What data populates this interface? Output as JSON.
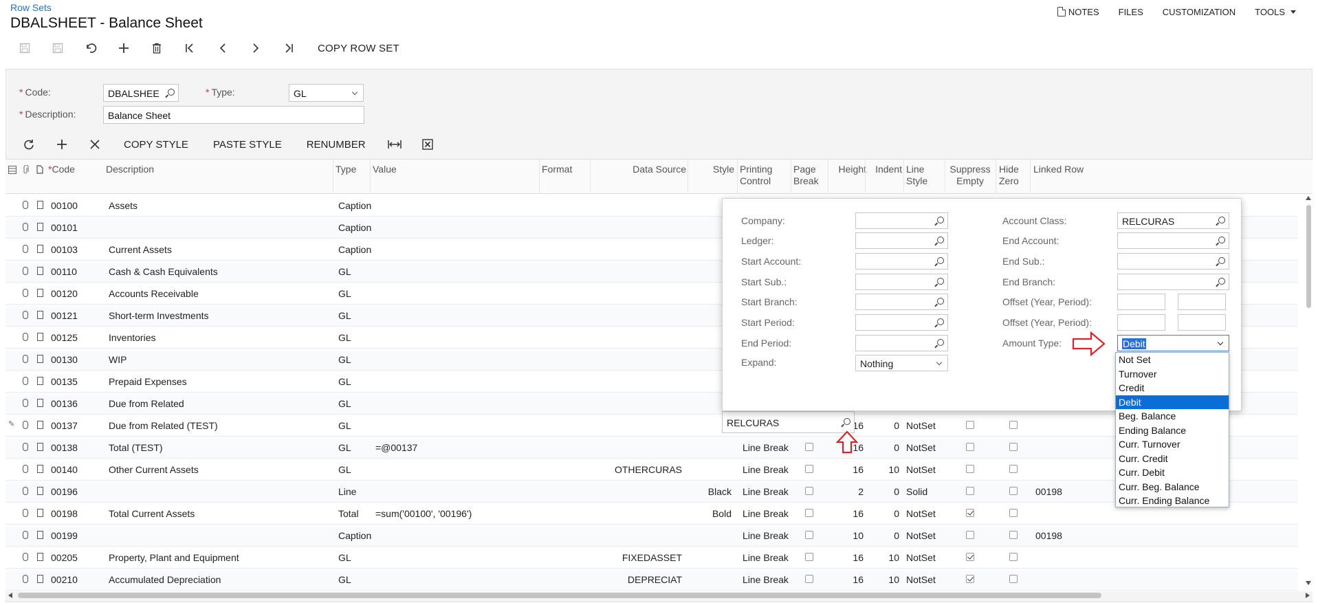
{
  "header": {
    "breadcrumb": "Row Sets",
    "title": "DBALSHEET - Balance Sheet",
    "actions": [
      {
        "label": "NOTES",
        "icon": "note-icon"
      },
      {
        "label": "FILES"
      },
      {
        "label": "CUSTOMIZATION"
      },
      {
        "label": "TOOLS",
        "dropdown": true
      }
    ]
  },
  "toolbar": {
    "icons": [
      "save-close-icon",
      "save-icon",
      "undo-icon",
      "add-icon",
      "delete-icon",
      "first-icon",
      "prev-icon",
      "next-icon",
      "last-icon"
    ],
    "copy_row_set": "COPY ROW SET"
  },
  "form": {
    "code_label": "Code:",
    "code_value": "DBALSHEE",
    "type_label": "Type:",
    "type_value": "GL",
    "description_label": "Description:",
    "description_value": "Balance Sheet"
  },
  "grid_toolbar": {
    "copy_style": "COPY STYLE",
    "paste_style": "PASTE STYLE",
    "renumber": "RENUMBER"
  },
  "columns": {
    "code": "Code",
    "description": "Description",
    "type": "Type",
    "value": "Value",
    "format": "Format",
    "data_source": "Data Source",
    "style": "Style",
    "printing_control_1": "Printing",
    "printing_control_2": "Control",
    "page_break_1": "Page",
    "page_break_2": "Break",
    "height": "Height",
    "indent": "Indent",
    "line_style_1": "Line",
    "line_style_2": "Style",
    "suppress_empty_1": "Suppress",
    "suppress_empty_2": "Empty",
    "hide_zero_1": "Hide",
    "hide_zero_2": "Zero",
    "linked_row": "Linked Row"
  },
  "rows": [
    {
      "code": "00100",
      "description": "Assets",
      "type": "Caption",
      "value": "",
      "data_source": "",
      "style": "",
      "printing": "",
      "height": "",
      "indent": "",
      "line_style": "",
      "linked": ""
    },
    {
      "code": "00101",
      "description": "",
      "type": "Caption",
      "value": "",
      "data_source": "",
      "style": "",
      "printing": "",
      "height": "",
      "indent": "",
      "line_style": "",
      "linked": ""
    },
    {
      "code": "00103",
      "description": "Current Assets",
      "type": "Caption",
      "value": "",
      "data_source": "",
      "style": "",
      "printing": "",
      "height": "",
      "indent": "",
      "line_style": "",
      "linked": "00198"
    },
    {
      "code": "00110",
      "description": "Cash & Cash Equivalents",
      "type": "GL",
      "value": "",
      "data_source": "",
      "style": "",
      "printing": "",
      "height": "",
      "indent": "",
      "line_style": "",
      "linked": ""
    },
    {
      "code": "00120",
      "description": "Accounts Receivable",
      "type": "GL",
      "value": "",
      "data_source": "",
      "style": "",
      "printing": "",
      "height": "",
      "indent": "",
      "line_style": "",
      "linked": ""
    },
    {
      "code": "00121",
      "description": "Short-term Investments",
      "type": "GL",
      "value": "",
      "data_source": "",
      "style": "",
      "printing": "",
      "height": "",
      "indent": "",
      "line_style": "",
      "linked": ""
    },
    {
      "code": "00125",
      "description": "Inventories",
      "type": "GL",
      "value": "",
      "data_source": "",
      "style": "",
      "printing": "",
      "height": "",
      "indent": "",
      "line_style": "",
      "linked": ""
    },
    {
      "code": "00130",
      "description": "WIP",
      "type": "GL",
      "value": "",
      "data_source": "",
      "style": "",
      "printing": "",
      "height": "",
      "indent": "",
      "line_style": "",
      "linked": ""
    },
    {
      "code": "00135",
      "description": "Prepaid Expenses",
      "type": "GL",
      "value": "",
      "data_source": "",
      "style": "",
      "printing": "",
      "height": "",
      "indent": "",
      "line_style": "",
      "linked": ""
    },
    {
      "code": "00136",
      "description": "Due from Related",
      "type": "GL",
      "value": "",
      "data_source": "",
      "style": "",
      "printing": "",
      "height": "",
      "indent": "",
      "line_style": "",
      "linked": ""
    },
    {
      "code": "00137",
      "description": "Due from Related (TEST)",
      "type": "GL",
      "value": "",
      "data_source": "",
      "style": "",
      "printing": "Line Break",
      "height": "16",
      "indent": "0",
      "line_style": "NotSet",
      "linked": ""
    },
    {
      "code": "00138",
      "description": "Total (TEST)",
      "type": "GL",
      "value": "=@00137",
      "data_source": "",
      "style": "",
      "printing": "Line Break",
      "height": "16",
      "indent": "0",
      "line_style": "NotSet",
      "linked": ""
    },
    {
      "code": "00140",
      "description": "Other Current Assets",
      "type": "GL",
      "value": "",
      "data_source": "OTHERCURAS",
      "style": "",
      "printing": "Line Break",
      "height": "16",
      "indent": "10",
      "line_style": "NotSet",
      "linked": ""
    },
    {
      "code": "00196",
      "description": "",
      "type": "Line",
      "value": "",
      "data_source": "",
      "style": "Black",
      "printing": "Line Break",
      "height": "2",
      "indent": "0",
      "line_style": "Solid",
      "linked": "00198"
    },
    {
      "code": "00198",
      "description": "Total Current Assets",
      "type": "Total",
      "value": "=sum('00100', '00196')",
      "data_source": "",
      "style": "Bold",
      "printing": "Line Break",
      "height": "16",
      "indent": "0",
      "line_style": "NotSet",
      "linked": ""
    },
    {
      "code": "00199",
      "description": "",
      "type": "Caption",
      "value": "",
      "data_source": "",
      "style": "",
      "printing": "Line Break",
      "height": "10",
      "indent": "0",
      "line_style": "NotSet",
      "linked": "00198"
    },
    {
      "code": "00205",
      "description": "Property, Plant and Equipment",
      "type": "GL",
      "value": "",
      "data_source": "FIXEDASSET",
      "style": "",
      "printing": "Line Break",
      "height": "16",
      "indent": "10",
      "line_style": "NotSet",
      "linked": ""
    },
    {
      "code": "00210",
      "description": "Accumulated Depreciation",
      "type": "GL",
      "value": "",
      "data_source": "DEPRECIAT",
      "style": "",
      "printing": "Line Break",
      "height": "16",
      "indent": "10",
      "line_style": "NotSet",
      "linked": ""
    }
  ],
  "popup": {
    "company": "Company:",
    "ledger": "Ledger:",
    "start_account": "Start Account:",
    "start_sub": "Start Sub.:",
    "start_branch": "Start Branch:",
    "start_period": "Start Period:",
    "end_period": "End Period:",
    "expand": "Expand:",
    "expand_value": "Nothing",
    "account_class": "Account Class:",
    "account_class_value": "RELCURAS",
    "end_account": "End Account:",
    "end_sub": "End Sub.:",
    "end_branch": "End Branch:",
    "offset1": "Offset (Year, Period):",
    "offset2": "Offset (Year, Period):",
    "amount_type": "Amount Type:",
    "amount_type_value": "Debit"
  },
  "data_source_cell": "RELCURAS",
  "amount_type_options": [
    "Not Set",
    "Turnover",
    "Credit",
    "Debit",
    "Beg. Balance",
    "Ending Balance",
    "Curr. Turnover",
    "Curr. Credit",
    "Curr. Debit",
    "Curr. Beg. Balance",
    "Curr. Ending Balance"
  ],
  "colors": {
    "accent": "#1a73c9",
    "selection": "#0b6dd6",
    "arrow": "#e0202a"
  }
}
